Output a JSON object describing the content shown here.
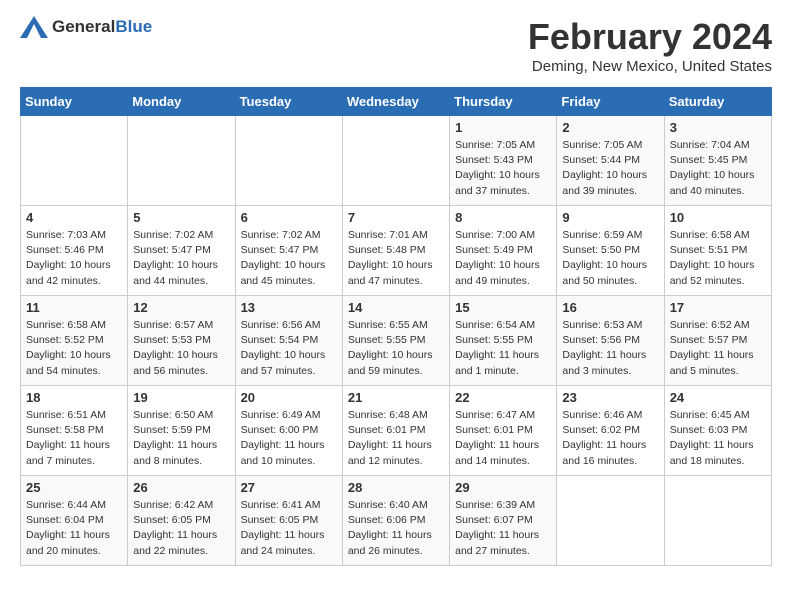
{
  "logo": {
    "general": "General",
    "blue": "Blue"
  },
  "title": {
    "month_year": "February 2024",
    "location": "Deming, New Mexico, United States"
  },
  "days_of_week": [
    "Sunday",
    "Monday",
    "Tuesday",
    "Wednesday",
    "Thursday",
    "Friday",
    "Saturday"
  ],
  "weeks": [
    [
      {
        "day": "",
        "info": ""
      },
      {
        "day": "",
        "info": ""
      },
      {
        "day": "",
        "info": ""
      },
      {
        "day": "",
        "info": ""
      },
      {
        "day": "1",
        "info": "Sunrise: 7:05 AM\nSunset: 5:43 PM\nDaylight: 10 hours\nand 37 minutes."
      },
      {
        "day": "2",
        "info": "Sunrise: 7:05 AM\nSunset: 5:44 PM\nDaylight: 10 hours\nand 39 minutes."
      },
      {
        "day": "3",
        "info": "Sunrise: 7:04 AM\nSunset: 5:45 PM\nDaylight: 10 hours\nand 40 minutes."
      }
    ],
    [
      {
        "day": "4",
        "info": "Sunrise: 7:03 AM\nSunset: 5:46 PM\nDaylight: 10 hours\nand 42 minutes."
      },
      {
        "day": "5",
        "info": "Sunrise: 7:02 AM\nSunset: 5:47 PM\nDaylight: 10 hours\nand 44 minutes."
      },
      {
        "day": "6",
        "info": "Sunrise: 7:02 AM\nSunset: 5:47 PM\nDaylight: 10 hours\nand 45 minutes."
      },
      {
        "day": "7",
        "info": "Sunrise: 7:01 AM\nSunset: 5:48 PM\nDaylight: 10 hours\nand 47 minutes."
      },
      {
        "day": "8",
        "info": "Sunrise: 7:00 AM\nSunset: 5:49 PM\nDaylight: 10 hours\nand 49 minutes."
      },
      {
        "day": "9",
        "info": "Sunrise: 6:59 AM\nSunset: 5:50 PM\nDaylight: 10 hours\nand 50 minutes."
      },
      {
        "day": "10",
        "info": "Sunrise: 6:58 AM\nSunset: 5:51 PM\nDaylight: 10 hours\nand 52 minutes."
      }
    ],
    [
      {
        "day": "11",
        "info": "Sunrise: 6:58 AM\nSunset: 5:52 PM\nDaylight: 10 hours\nand 54 minutes."
      },
      {
        "day": "12",
        "info": "Sunrise: 6:57 AM\nSunset: 5:53 PM\nDaylight: 10 hours\nand 56 minutes."
      },
      {
        "day": "13",
        "info": "Sunrise: 6:56 AM\nSunset: 5:54 PM\nDaylight: 10 hours\nand 57 minutes."
      },
      {
        "day": "14",
        "info": "Sunrise: 6:55 AM\nSunset: 5:55 PM\nDaylight: 10 hours\nand 59 minutes."
      },
      {
        "day": "15",
        "info": "Sunrise: 6:54 AM\nSunset: 5:55 PM\nDaylight: 11 hours\nand 1 minute."
      },
      {
        "day": "16",
        "info": "Sunrise: 6:53 AM\nSunset: 5:56 PM\nDaylight: 11 hours\nand 3 minutes."
      },
      {
        "day": "17",
        "info": "Sunrise: 6:52 AM\nSunset: 5:57 PM\nDaylight: 11 hours\nand 5 minutes."
      }
    ],
    [
      {
        "day": "18",
        "info": "Sunrise: 6:51 AM\nSunset: 5:58 PM\nDaylight: 11 hours\nand 7 minutes."
      },
      {
        "day": "19",
        "info": "Sunrise: 6:50 AM\nSunset: 5:59 PM\nDaylight: 11 hours\nand 8 minutes."
      },
      {
        "day": "20",
        "info": "Sunrise: 6:49 AM\nSunset: 6:00 PM\nDaylight: 11 hours\nand 10 minutes."
      },
      {
        "day": "21",
        "info": "Sunrise: 6:48 AM\nSunset: 6:01 PM\nDaylight: 11 hours\nand 12 minutes."
      },
      {
        "day": "22",
        "info": "Sunrise: 6:47 AM\nSunset: 6:01 PM\nDaylight: 11 hours\nand 14 minutes."
      },
      {
        "day": "23",
        "info": "Sunrise: 6:46 AM\nSunset: 6:02 PM\nDaylight: 11 hours\nand 16 minutes."
      },
      {
        "day": "24",
        "info": "Sunrise: 6:45 AM\nSunset: 6:03 PM\nDaylight: 11 hours\nand 18 minutes."
      }
    ],
    [
      {
        "day": "25",
        "info": "Sunrise: 6:44 AM\nSunset: 6:04 PM\nDaylight: 11 hours\nand 20 minutes."
      },
      {
        "day": "26",
        "info": "Sunrise: 6:42 AM\nSunset: 6:05 PM\nDaylight: 11 hours\nand 22 minutes."
      },
      {
        "day": "27",
        "info": "Sunrise: 6:41 AM\nSunset: 6:05 PM\nDaylight: 11 hours\nand 24 minutes."
      },
      {
        "day": "28",
        "info": "Sunrise: 6:40 AM\nSunset: 6:06 PM\nDaylight: 11 hours\nand 26 minutes."
      },
      {
        "day": "29",
        "info": "Sunrise: 6:39 AM\nSunset: 6:07 PM\nDaylight: 11 hours\nand 27 minutes."
      },
      {
        "day": "",
        "info": ""
      },
      {
        "day": "",
        "info": ""
      }
    ]
  ]
}
